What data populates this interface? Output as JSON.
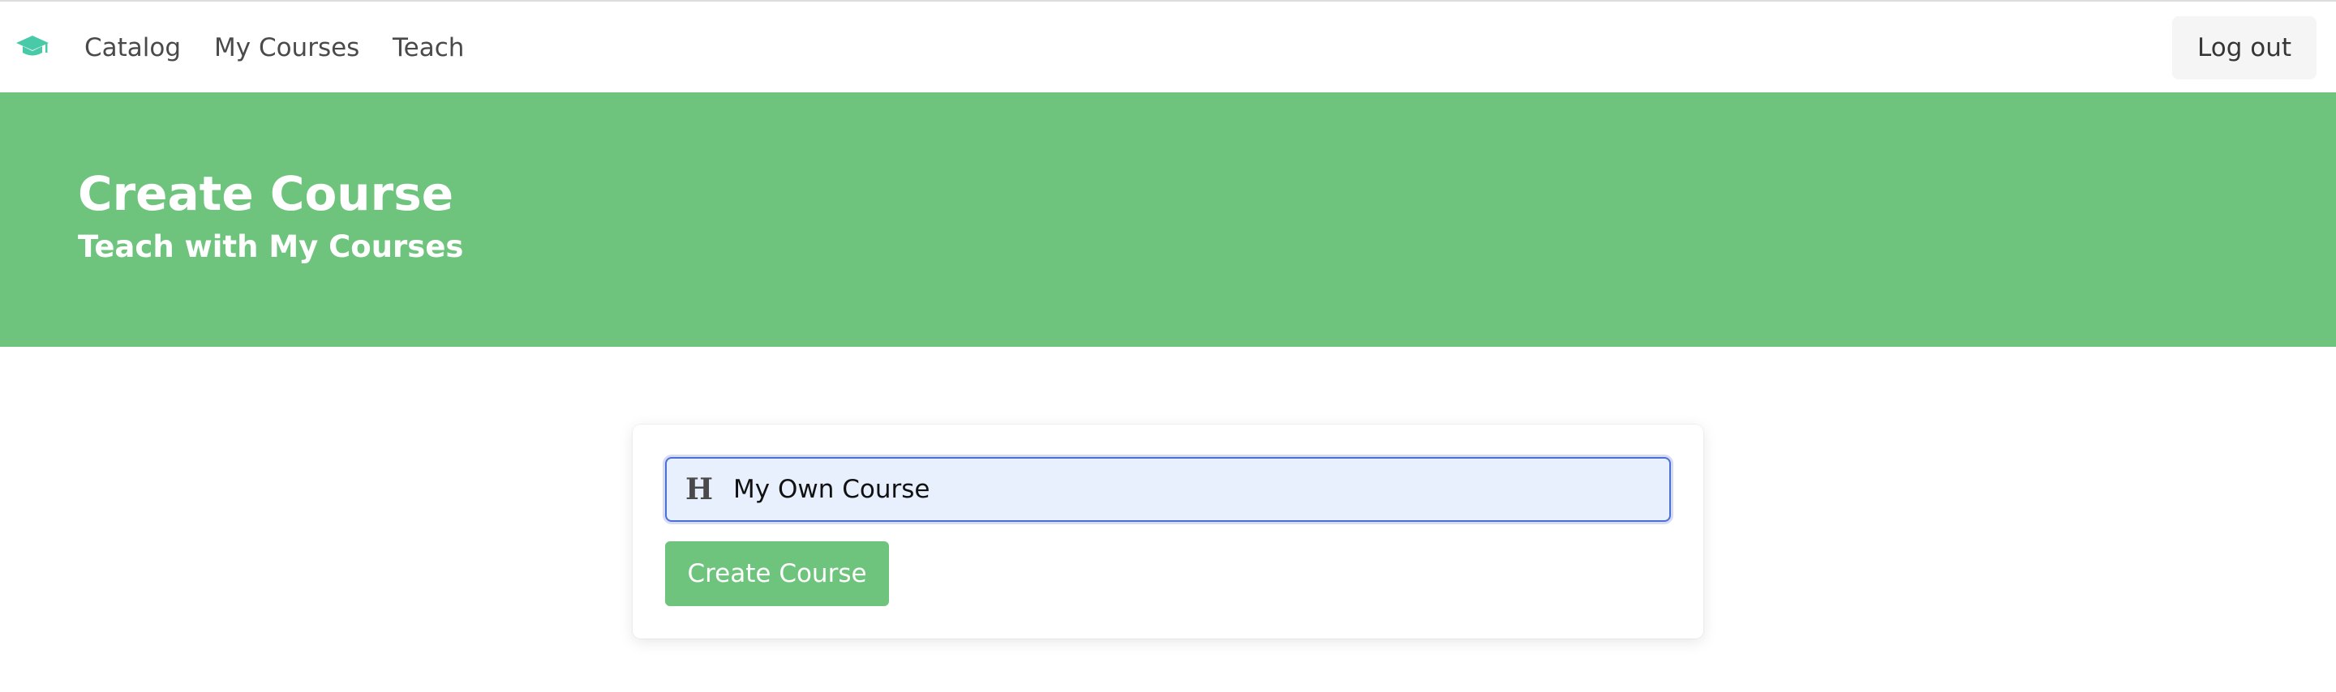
{
  "nav": {
    "logo_icon": "graduation-cap-icon",
    "logo_color": "#48c9a8",
    "items": [
      {
        "label": "Catalog"
      },
      {
        "label": "My Courses"
      },
      {
        "label": "Teach"
      }
    ],
    "logout_label": "Log out"
  },
  "hero": {
    "title": "Create Course",
    "subtitle": "Teach with My Courses",
    "background": "#6ec47d"
  },
  "form": {
    "title_field": {
      "icon": "heading-icon",
      "icon_glyph": "H",
      "value": "My Own Course"
    },
    "submit_label": "Create Course"
  }
}
